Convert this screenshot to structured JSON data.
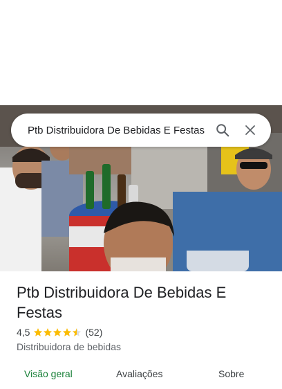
{
  "search": {
    "query": "Ptb Distribuidora De Bebidas E Festas",
    "search_icon": "search-icon",
    "close_icon": "close-icon"
  },
  "place": {
    "name": "Ptb Distribuidora De Bebidas E Festas",
    "rating": "4,5",
    "rating_value": 4.5,
    "reviews_count": "(52)",
    "category": "Distribuidora de bebidas",
    "star_color": "#fbbc04"
  },
  "tabs": [
    {
      "label": "Visão geral",
      "active": true
    },
    {
      "label": "Avaliações",
      "active": false
    },
    {
      "label": "Sobre",
      "active": false
    }
  ],
  "colors": {
    "active_tab": "#188038",
    "text_primary": "#202124",
    "text_secondary": "#5f6368"
  }
}
